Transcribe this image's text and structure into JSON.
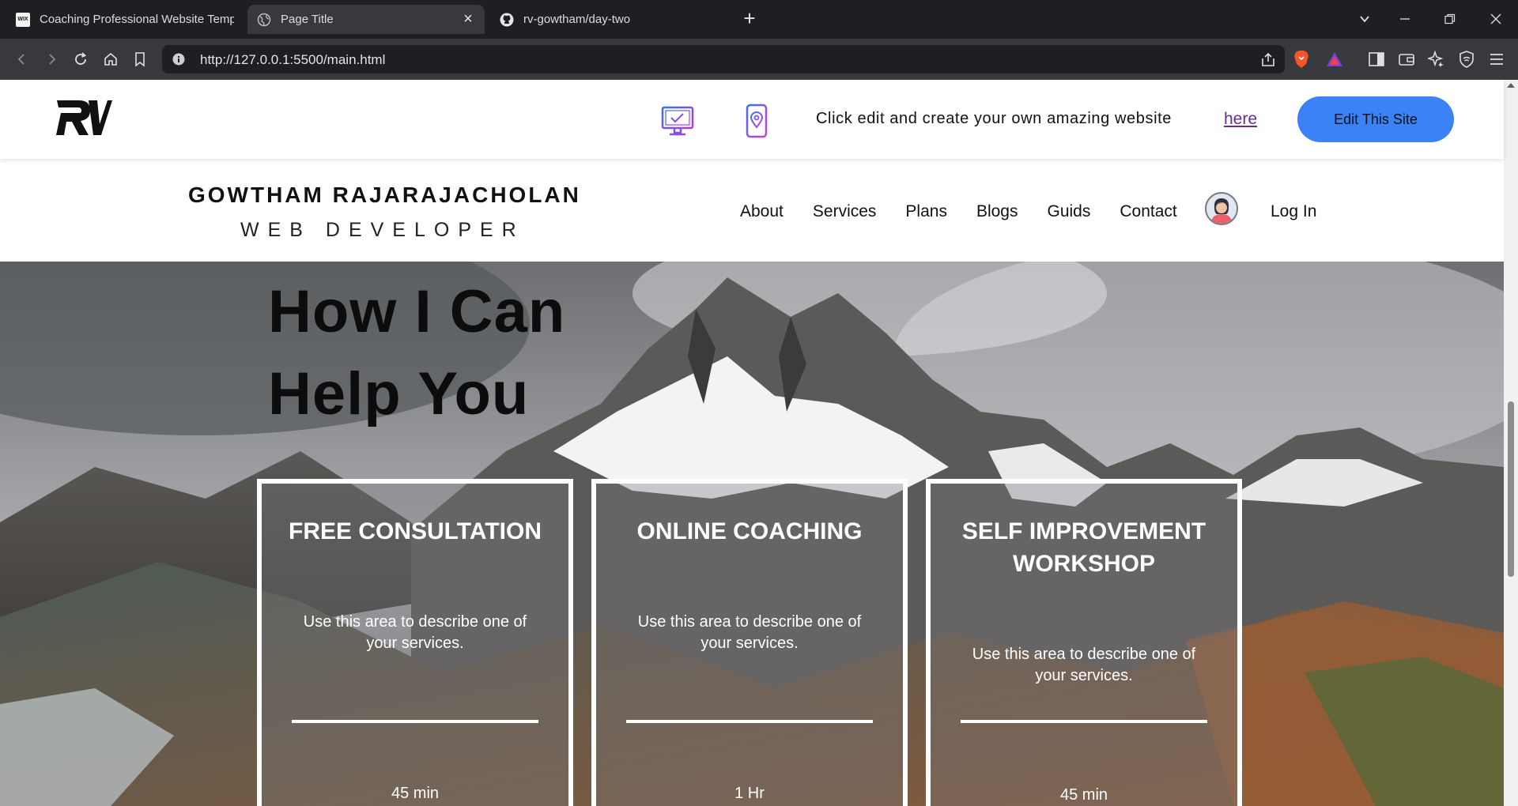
{
  "browser": {
    "tabs": [
      {
        "title": "Coaching Professional Website Templ",
        "icon": "wix-icon",
        "active": false
      },
      {
        "title": "Page Title",
        "icon": "globe-icon",
        "active": true
      },
      {
        "title": "rv-gowtham/day-two",
        "icon": "github-icon",
        "active": false
      }
    ],
    "new_tab": "+",
    "url": "http://127.0.0.1:5500/main.html"
  },
  "wix_bar": {
    "logo": "RV",
    "promo_text": "Click edit and create your own amazing website",
    "here_link": "here",
    "edit_button": "Edit This Site",
    "colors": {
      "button": "#3b82f6",
      "link": "#6a2c91"
    }
  },
  "site_header": {
    "name": "GOWTHAM RAJARAJACHOLAN",
    "subtitle": "WEB DEVELOPER",
    "menu": [
      "About",
      "Services",
      "Plans",
      "Blogs",
      "Guids",
      "Contact"
    ],
    "login": "Log In"
  },
  "hero": {
    "title_line1": "How I Can",
    "title_line2": "Help You"
  },
  "services": [
    {
      "title": "FREE CONSULTATION",
      "description": "Use this area to describe one of your services.",
      "duration": "45 min"
    },
    {
      "title": "ONLINE COACHING",
      "description": "Use this area to describe one of your services.",
      "duration": "1 Hr"
    },
    {
      "title": "SELF IMPROVEMENT WORKSHOP",
      "description": "Use this area to describe one of your services.",
      "duration": "45 min"
    }
  ]
}
